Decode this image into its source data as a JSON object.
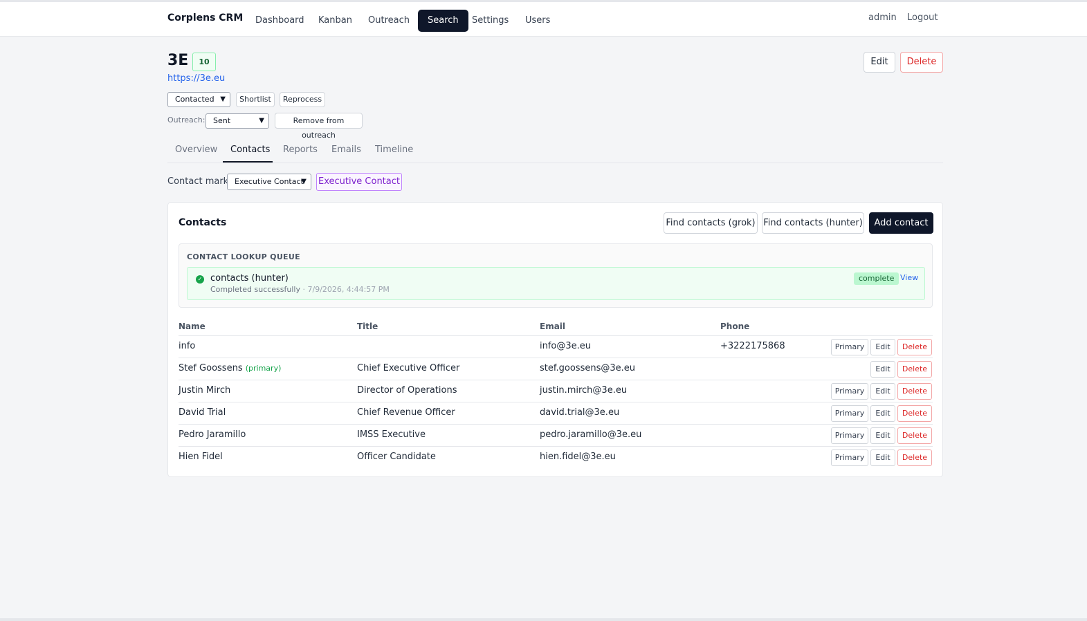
{
  "nav": {
    "brand": "Corplens CRM",
    "items": [
      "Dashboard",
      "Kanban",
      "Outreach",
      "Search",
      "Settings",
      "Users"
    ],
    "active": "Search",
    "user": "admin",
    "logout": "Logout"
  },
  "company": {
    "name": "3E",
    "score": "10",
    "url": "https://3e.eu",
    "edit_label": "Edit",
    "delete_label": "Delete",
    "status_value": "Contacted",
    "shortlist_label": "Shortlist",
    "reprocess_label": "Reprocess",
    "outreach_label": "Outreach:",
    "outreach_value": "Sent",
    "remove_outreach_label": "Remove from outreach"
  },
  "tabs": [
    "Overview",
    "Contacts",
    "Reports",
    "Emails",
    "Timeline"
  ],
  "active_tab": "Contacts",
  "contact_mark": {
    "label": "Contact mark:",
    "value": "Executive Contact",
    "badge": "Executive Contact"
  },
  "contacts_card": {
    "title": "Contacts",
    "find_grok": "Find contacts (grok)",
    "find_hunter": "Find contacts (hunter)",
    "add_contact": "Add contact",
    "queue": {
      "title": "CONTACT LOOKUP QUEUE",
      "job_name": "contacts (hunter)",
      "job_status_text": "Completed successfully",
      "job_timestamp": " · 7/9/2026, 4:44:57 PM",
      "status_badge": "complete",
      "view_label": "View"
    },
    "columns": [
      "Name",
      "Title",
      "Email",
      "Phone"
    ],
    "primary_tag": "(primary)",
    "row_buttons": {
      "primary": "Primary",
      "edit": "Edit",
      "delete": "Delete"
    },
    "rows": [
      {
        "name": "info",
        "title": "",
        "email": "info@3e.eu",
        "phone": "+3222175868",
        "is_primary": false
      },
      {
        "name": "Stef Goossens",
        "title": "Chief Executive Officer",
        "email": "stef.goossens@3e.eu",
        "phone": "",
        "is_primary": true
      },
      {
        "name": "Justin Mirch",
        "title": "Director of Operations",
        "email": "justin.mirch@3e.eu",
        "phone": "",
        "is_primary": false
      },
      {
        "name": "David Trial",
        "title": "Chief Revenue Officer",
        "email": "david.trial@3e.eu",
        "phone": "",
        "is_primary": false
      },
      {
        "name": "Pedro Jaramillo",
        "title": "IMSS Executive",
        "email": "pedro.jaramillo@3e.eu",
        "phone": "",
        "is_primary": false
      },
      {
        "name": "Hien Fidel",
        "title": "Officer Candidate",
        "email": "hien.fidel@3e.eu",
        "phone": "",
        "is_primary": false
      }
    ]
  },
  "colors": {
    "accent": "#0f172a",
    "danger": "#dc2626",
    "success": "#16a34a",
    "link": "#2563eb",
    "mark": "#7e22ce"
  }
}
